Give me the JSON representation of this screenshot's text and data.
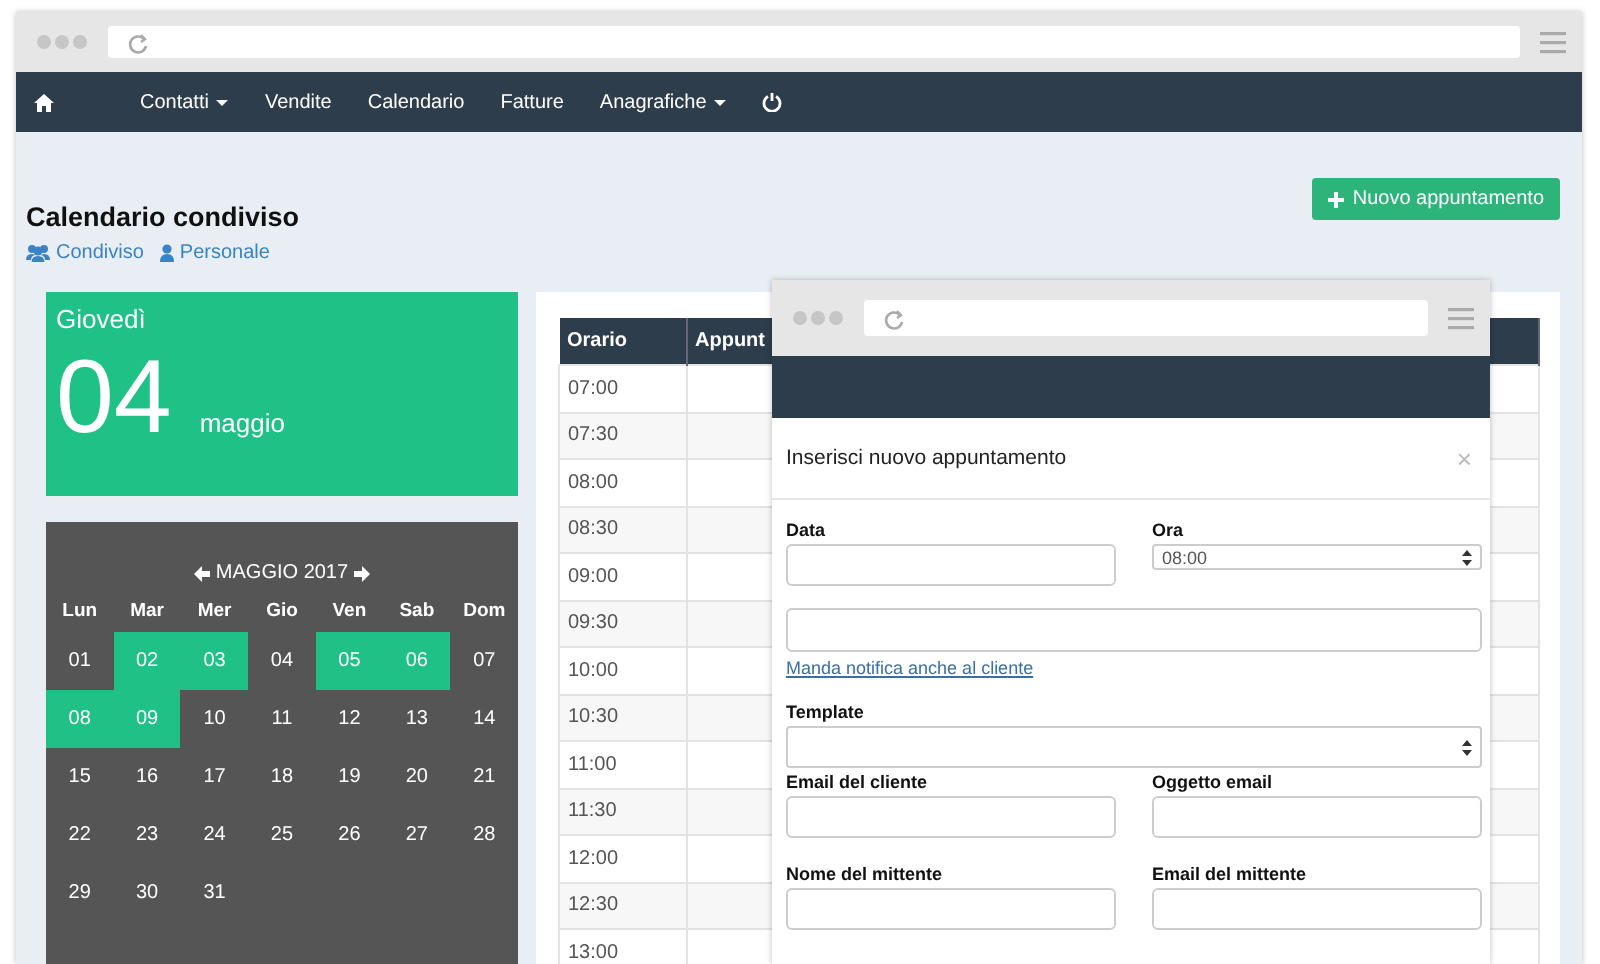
{
  "back_window": {
    "nav": [
      {
        "label": "Contatti",
        "dropdown": true
      },
      {
        "label": "Vendite",
        "dropdown": false
      },
      {
        "label": "Calendario",
        "dropdown": false
      },
      {
        "label": "Fatture",
        "dropdown": false
      },
      {
        "label": "Anagrafiche",
        "dropdown": true
      }
    ],
    "page_title": "Calendario condiviso",
    "view_links": [
      {
        "kind": "group",
        "label": "Condiviso"
      },
      {
        "kind": "single",
        "label": "Personale"
      }
    ],
    "new_button": "Nuovo appuntamento",
    "day_card": {
      "weekday": "Giovedì",
      "day": "04",
      "month": "maggio"
    },
    "mini_calendar": {
      "title": "MAGGIO 2017",
      "weekdays": [
        "Lun",
        "Mar",
        "Mer",
        "Gio",
        "Ven",
        "Sab",
        "Dom"
      ],
      "weeks": [
        [
          {
            "label": "01",
            "selected": false
          },
          {
            "label": "02",
            "selected": true
          },
          {
            "label": "03",
            "selected": true
          },
          {
            "label": "04",
            "selected": false
          },
          {
            "label": "05",
            "selected": true
          },
          {
            "label": "06",
            "selected": true
          },
          {
            "label": "07",
            "selected": false
          }
        ],
        [
          {
            "label": "08",
            "selected": true
          },
          {
            "label": "09",
            "selected": true
          },
          {
            "label": "10",
            "selected": false
          },
          {
            "label": "11",
            "selected": false
          },
          {
            "label": "12",
            "selected": false
          },
          {
            "label": "13",
            "selected": false
          },
          {
            "label": "14",
            "selected": false
          }
        ],
        [
          {
            "label": "15",
            "selected": false
          },
          {
            "label": "16",
            "selected": false
          },
          {
            "label": "17",
            "selected": false
          },
          {
            "label": "18",
            "selected": false
          },
          {
            "label": "19",
            "selected": false
          },
          {
            "label": "20",
            "selected": false
          },
          {
            "label": "21",
            "selected": false
          }
        ],
        [
          {
            "label": "22",
            "selected": false
          },
          {
            "label": "23",
            "selected": false
          },
          {
            "label": "24",
            "selected": false
          },
          {
            "label": "25",
            "selected": false
          },
          {
            "label": "26",
            "selected": false
          },
          {
            "label": "27",
            "selected": false
          },
          {
            "label": "28",
            "selected": false
          }
        ],
        [
          {
            "label": "29",
            "selected": false
          },
          {
            "label": "30",
            "selected": false
          },
          {
            "label": "31",
            "selected": false
          }
        ]
      ]
    },
    "table": {
      "columns": [
        "Orario",
        "Appunt"
      ],
      "rows": [
        "07:00",
        "07:30",
        "08:00",
        "08:30",
        "09:00",
        "09:30",
        "10:00",
        "10:30",
        "11:00",
        "11:30",
        "12:00",
        "12:30",
        "13:00"
      ]
    }
  },
  "front_window": {
    "dialog": {
      "title": "Inserisci nuovo appuntamento",
      "close": "×",
      "rows": [
        [
          {
            "kind": "input",
            "label": "Data"
          },
          {
            "kind": "select",
            "label": "Ora",
            "value": "08:00"
          }
        ],
        [
          {
            "kind": "textarea"
          }
        ],
        [
          {
            "kind": "link",
            "label": "Manda notifica anche al cliente"
          }
        ],
        [
          {
            "kind": "select",
            "label": "Template"
          }
        ],
        [
          {
            "kind": "input",
            "label": "Email del cliente"
          },
          {
            "kind": "input",
            "label": "Oggetto email"
          }
        ],
        [
          {
            "kind": "input",
            "label": "Nome del mittente"
          },
          {
            "kind": "input",
            "label": "Email del mittente"
          }
        ]
      ]
    }
  }
}
